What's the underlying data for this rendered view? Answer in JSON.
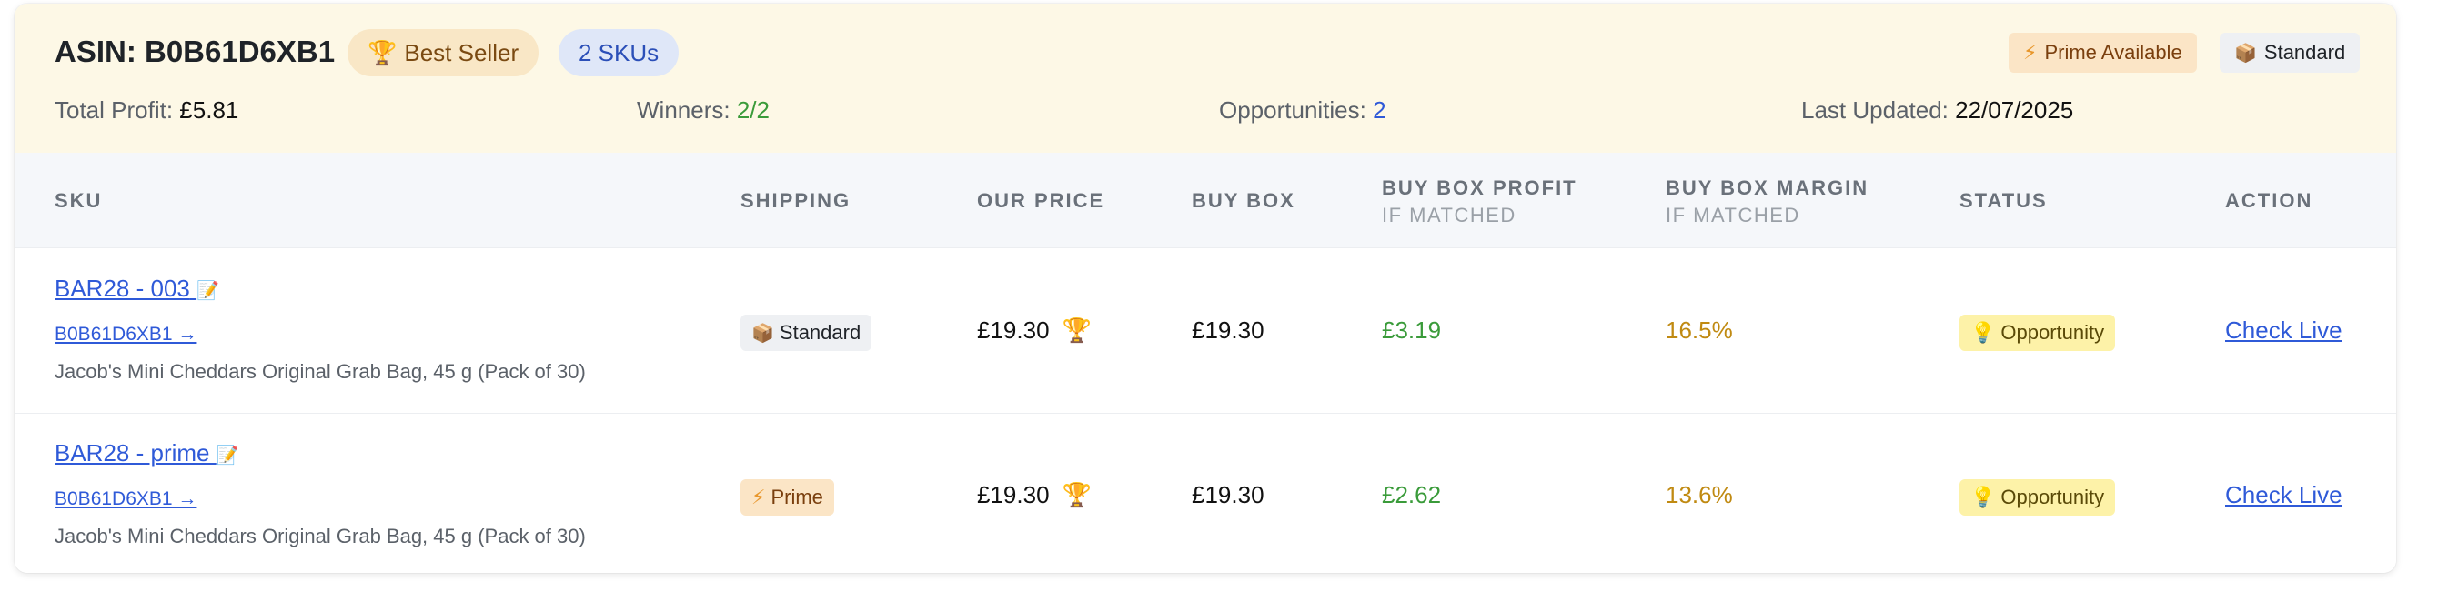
{
  "header": {
    "asin_label": "ASIN: B0B61D6XB1",
    "best_seller": "Best Seller",
    "skus_badge": "2 SKUs",
    "prime_available": "Prime Available",
    "standard": "Standard",
    "total_profit_label": "Total Profit:",
    "total_profit_value": "£5.81",
    "winners_label": "Winners:",
    "winners_value": "2/2",
    "opportunities_label": "Opportunities:",
    "opportunities_value": "2",
    "last_updated_label": "Last Updated:",
    "last_updated_value": "22/07/2025"
  },
  "columns": {
    "sku": "SKU",
    "shipping": "SHIPPING",
    "our_price": "OUR PRICE",
    "buy_box": "BUY BOX",
    "buy_box_profit": "BUY BOX PROFIT",
    "buy_box_profit_sub": "IF MATCHED",
    "buy_box_margin": "BUY BOX MARGIN",
    "buy_box_margin_sub": "IF MATCHED",
    "status": "STATUS",
    "action": "ACTION"
  },
  "rows": [
    {
      "sku": "BAR28 - 003",
      "asin_link": "B0B61D6XB1 →",
      "product": "Jacob's Mini Cheddars Original Grab Bag, 45 g (Pack of 30)",
      "shipping": "Standard",
      "our_price": "£19.30",
      "buy_box": "£19.30",
      "profit": "£3.19",
      "margin": "16.5%",
      "status": "Opportunity",
      "action": "Check Live"
    },
    {
      "sku": "BAR28 - prime",
      "asin_link": "B0B61D6XB1 →",
      "product": "Jacob's Mini Cheddars Original Grab Bag, 45 g (Pack of 30)",
      "shipping": "Prime",
      "our_price": "£19.30",
      "buy_box": "£19.30",
      "profit": "£2.62",
      "margin": "13.6%",
      "status": "Opportunity",
      "action": "Check Live"
    }
  ],
  "colors": {
    "header_bg": "#fdf8e6",
    "link_blue": "#2f5ad8",
    "profit_green": "#3a9b3a",
    "margin_amber": "#c08a12",
    "status_yellow": "#fdf2a8"
  }
}
